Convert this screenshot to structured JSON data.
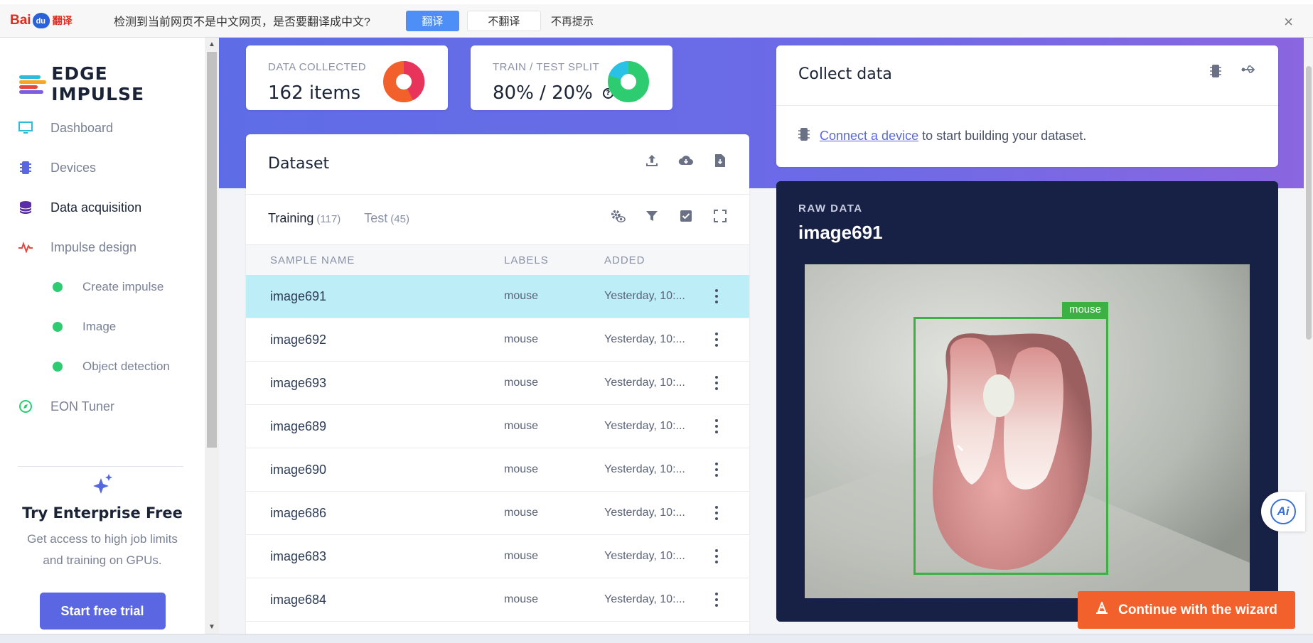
{
  "translate_bar": {
    "logo_text": "Bai",
    "logo_fy": "翻译",
    "message": "检测到当前网页不是中文网页，是否要翻译成中文?",
    "translate_label": "翻译",
    "no_translate_label": "不翻译",
    "no_remind_label": "不再提示",
    "close_glyph": "×"
  },
  "brand": {
    "name": "EDGE IMPULSE"
  },
  "nav": {
    "items": [
      {
        "label": "Dashboard"
      },
      {
        "label": "Devices"
      },
      {
        "label": "Data acquisition"
      },
      {
        "label": "Impulse design"
      }
    ],
    "sub_items": [
      {
        "label": "Create impulse"
      },
      {
        "label": "Image"
      },
      {
        "label": "Object detection"
      }
    ],
    "eon": {
      "label": "EON Tuner"
    }
  },
  "promo": {
    "title": "Try Enterprise Free",
    "text_line1": "Get access to high job limits",
    "text_line2": "and training on GPUs.",
    "button": "Start free trial"
  },
  "stats": {
    "collected_label": "DATA COLLECTED",
    "collected_value": "162 items",
    "split_label": "TRAIN / TEST SPLIT",
    "split_value": "80% / 20%",
    "split_train_fraction": 0.8
  },
  "dataset": {
    "title": "Dataset",
    "tabs": [
      {
        "label": "Training",
        "count": "(117)"
      },
      {
        "label": "Test",
        "count": "(45)"
      }
    ],
    "columns": {
      "name": "SAMPLE NAME",
      "labels": "LABELS",
      "added": "ADDED"
    },
    "rows": [
      {
        "name": "image691",
        "label": "mouse",
        "added": "Yesterday, 10:..."
      },
      {
        "name": "image692",
        "label": "mouse",
        "added": "Yesterday, 10:..."
      },
      {
        "name": "image693",
        "label": "mouse",
        "added": "Yesterday, 10:..."
      },
      {
        "name": "image689",
        "label": "mouse",
        "added": "Yesterday, 10:..."
      },
      {
        "name": "image690",
        "label": "mouse",
        "added": "Yesterday, 10:..."
      },
      {
        "name": "image686",
        "label": "mouse",
        "added": "Yesterday, 10:..."
      },
      {
        "name": "image683",
        "label": "mouse",
        "added": "Yesterday, 10:..."
      },
      {
        "name": "image684",
        "label": "mouse",
        "added": "Yesterday, 10:..."
      }
    ]
  },
  "collect": {
    "title": "Collect data",
    "link_text": "Connect a device",
    "message_rest": "to start building your dataset."
  },
  "raw": {
    "label": "RAW DATA",
    "title": "image691",
    "bbox_label": "mouse"
  },
  "ai_label": "Ai",
  "wizard_label": "Continue with the wizard",
  "colors": {
    "accent": "#5b67e2",
    "selected_row": "#bdeef8",
    "bbox_green": "#3cb043",
    "wizard_orange": "#f2602c"
  }
}
